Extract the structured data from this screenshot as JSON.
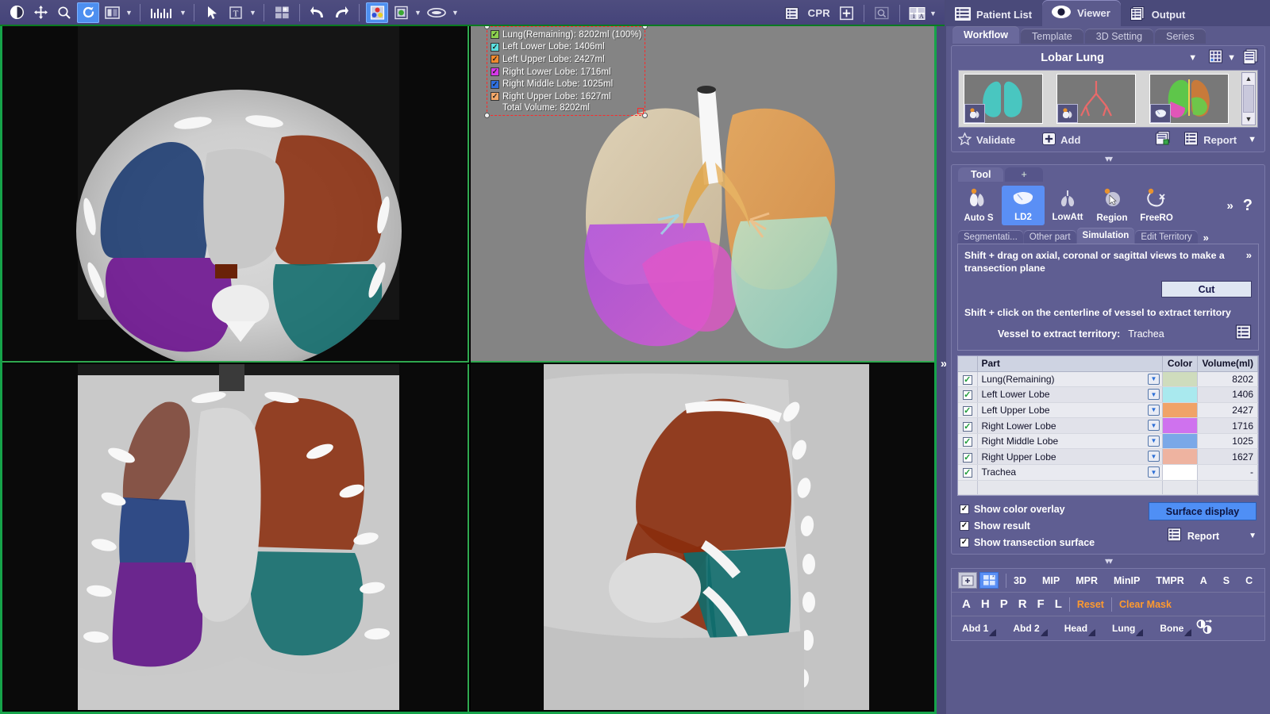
{
  "toolbar": {
    "tools": [
      {
        "name": "window-level-icon",
        "label": "",
        "selected": false
      },
      {
        "name": "pan-icon",
        "label": "",
        "selected": false
      },
      {
        "name": "zoom-icon",
        "label": "",
        "selected": false
      },
      {
        "name": "rotate-icon",
        "label": "",
        "selected": true
      },
      {
        "name": "flip-icon",
        "label": "",
        "selected": false
      },
      {
        "name": "measure-icon",
        "label": "",
        "selected": false
      },
      {
        "name": "pointer-icon",
        "label": "",
        "selected": false
      },
      {
        "name": "text-annotation-icon",
        "label": "",
        "selected": false
      },
      {
        "name": "layout-grid-icon",
        "label": "",
        "selected": false
      },
      {
        "name": "undo-icon",
        "label": "",
        "selected": false
      },
      {
        "name": "redo-icon",
        "label": "",
        "selected": false
      },
      {
        "name": "color-overlay-icon",
        "label": "",
        "selected": true
      },
      {
        "name": "mask-icon",
        "label": "",
        "selected": false
      },
      {
        "name": "ellipse-roi-icon",
        "label": "",
        "selected": false
      }
    ],
    "cpr_label": "CPR",
    "right_icons": [
      "list-icon",
      "plus-box-icon",
      "magnifier-box-icon",
      "info-annotation-icon"
    ]
  },
  "legend": {
    "rows": [
      {
        "label": "Lung(Remaining): 8202ml (100%)",
        "color": "#8ccf4e"
      },
      {
        "label": "Left Lower Lobe: 1406ml",
        "color": "#5ce0e0"
      },
      {
        "label": "Left Upper Lobe: 2427ml",
        "color": "#f08a2e"
      },
      {
        "label": "Right Lower Lobe: 1716ml",
        "color": "#d638e8"
      },
      {
        "label": "Right Middle Lobe: 1025ml",
        "color": "#2f6fe0"
      },
      {
        "label": "Right Upper Lobe: 1627ml",
        "color": "#f2a86a"
      }
    ],
    "total": "Total Volume: 8202ml"
  },
  "app_tabs": [
    {
      "label": "Patient List",
      "icon": "list-icon",
      "active": false
    },
    {
      "label": "Viewer",
      "icon": "eye-icon",
      "active": true
    },
    {
      "label": "Output",
      "icon": "documents-icon",
      "active": false
    }
  ],
  "sub_tabs": [
    {
      "label": "Workflow",
      "active": true
    },
    {
      "label": "Template",
      "active": false
    },
    {
      "label": "3D Setting",
      "active": false
    },
    {
      "label": "Series",
      "active": false
    }
  ],
  "workflow": {
    "title": "Lobar Lung",
    "thumbnails": [
      {
        "name": "lung-surface-thumbnail",
        "badge": "snapshot-icon"
      },
      {
        "name": "airway-tree-thumbnail",
        "badge": "snapshot-icon"
      },
      {
        "name": "lobar-segmentation-thumbnail",
        "badge": "liver-icon"
      }
    ],
    "validate_label": "Validate",
    "add_label": "Add",
    "report_label": "Report"
  },
  "tool_panel": {
    "tabs": [
      {
        "label": "Tool",
        "active": true
      },
      {
        "label": "+",
        "active": false
      }
    ],
    "tools": [
      {
        "label": "Auto S",
        "icon": "auto-segment-icon",
        "selected": false
      },
      {
        "label": "LD2",
        "icon": "liver-icon",
        "selected": true
      },
      {
        "label": "LowAtt",
        "icon": "lung-low-attenuation-icon",
        "selected": false
      },
      {
        "label": "Region",
        "icon": "region-select-icon",
        "selected": false
      },
      {
        "label": "FreeRO",
        "icon": "free-roi-icon",
        "selected": false
      }
    ],
    "more_label": "»",
    "help_label": "?"
  },
  "mode_tabs": [
    {
      "label": "Segmentati...",
      "active": false
    },
    {
      "label": "Other part",
      "active": false
    },
    {
      "label": "Simulation",
      "active": true
    },
    {
      "label": "Edit Territory",
      "active": false
    }
  ],
  "simulation": {
    "hint1": "Shift + drag on axial, coronal or sagittal views to make a transection plane",
    "cut_label": "Cut",
    "hint2": "Shift + click on the centerline of vessel to extract territory",
    "vessel_label": "Vessel to extract territory:",
    "vessel_value": "Trachea",
    "vessel_list_icon": "list-icon"
  },
  "table": {
    "headers": [
      "",
      "Part",
      "Color",
      "Volume(ml)"
    ],
    "rows": [
      {
        "checked": true,
        "part": "Lung(Remaining)",
        "color": "#cfdcbd",
        "volume": "8202"
      },
      {
        "checked": true,
        "part": "Left Lower Lobe",
        "color": "#a9e9ee",
        "volume": "1406"
      },
      {
        "checked": true,
        "part": "Left Upper Lobe",
        "color": "#f0a368",
        "volume": "2427"
      },
      {
        "checked": true,
        "part": "Right Lower Lobe",
        "color": "#cf72ee",
        "volume": "1716"
      },
      {
        "checked": true,
        "part": "Right Middle Lobe",
        "color": "#7aa8e8",
        "volume": "1025"
      },
      {
        "checked": true,
        "part": "Right Upper Lobe",
        "color": "#eeb3a0",
        "volume": "1627"
      },
      {
        "checked": true,
        "part": "Trachea",
        "color": "#ffffff",
        "volume": "-"
      }
    ]
  },
  "options": {
    "show_color_overlay": "Show color overlay",
    "show_result": "Show result",
    "show_transection_surface": "Show transection surface",
    "surface_display_label": "Surface display",
    "report_label": "Report"
  },
  "bottom": {
    "row1": [
      "3D",
      "MIP",
      "MPR",
      "MinIP",
      "TMPR",
      "A",
      "S",
      "C"
    ],
    "row2": [
      "A",
      "H",
      "P",
      "R",
      "F",
      "L"
    ],
    "reset_label": "Reset",
    "clear_mask_label": "Clear Mask",
    "presets": [
      "Abd 1",
      "Abd 2",
      "Head",
      "Lung",
      "Bone"
    ]
  },
  "colors": {
    "panel_bg": "#5b5a8c",
    "accent_blue": "#5a8ff5",
    "accent_orange": "#ff9a2e",
    "viewport_border": "#16a34a"
  }
}
